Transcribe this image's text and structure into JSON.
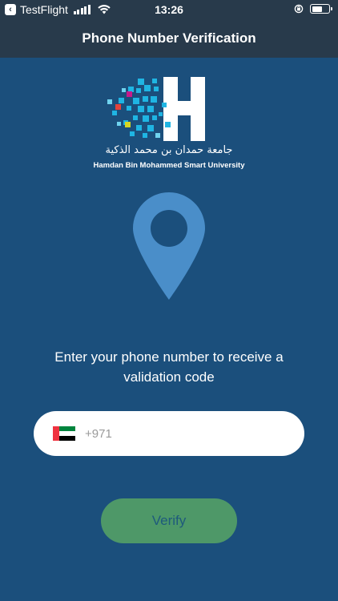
{
  "status_bar": {
    "app_name": "TestFlight",
    "time": "13:26",
    "icons": [
      "back-badge-icon",
      "signal-icon",
      "wifi-icon",
      "orientation-lock-icon",
      "battery-icon"
    ]
  },
  "nav": {
    "title": "Phone Number Verification"
  },
  "logo": {
    "arabic_name": "جامعة حمدان بن محمد الذكية",
    "english_name": "Hamdan Bin Mohammed Smart University",
    "colors": {
      "mosaic_primary": "#1fb5e3",
      "accent_red": "#e2443c",
      "accent_yellow": "#d6d622",
      "accent_magenta": "#c7198b"
    }
  },
  "pin": {
    "icon": "location-pin-icon",
    "color": "#4a8ec9"
  },
  "instruction": "Enter your phone number to receive a validation code",
  "phone_field": {
    "flag": "uae-flag-icon",
    "value": "",
    "placeholder": "+971"
  },
  "verify_button": {
    "label": "Verify",
    "color": "#4e9868"
  },
  "colors": {
    "background": "#1b4f7c",
    "header": "#283a4b"
  }
}
